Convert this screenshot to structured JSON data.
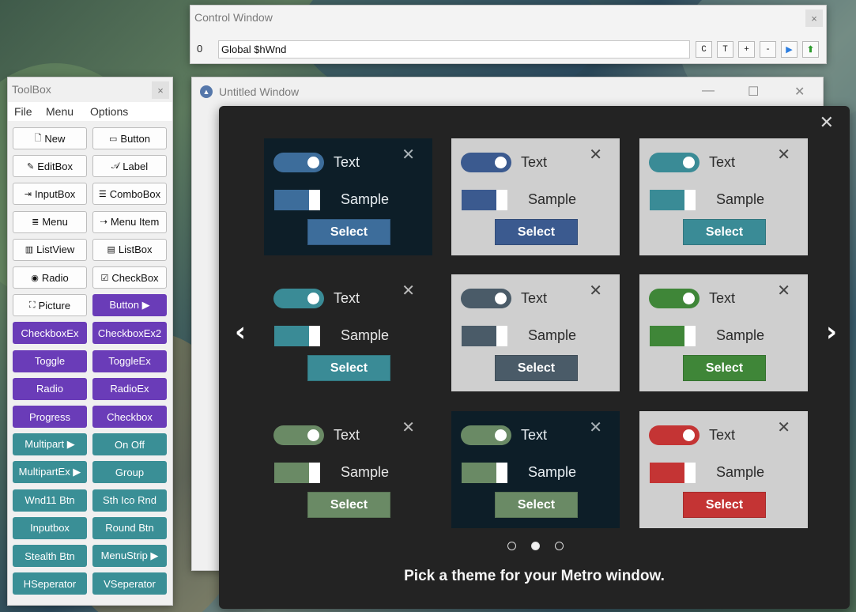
{
  "control_window": {
    "title": "Control Window",
    "close": "×",
    "handle_value": "0",
    "input_value": "Global $hWnd",
    "buttons": [
      "C",
      "T",
      "+",
      "-"
    ],
    "play_icon": "▶",
    "up_icon": "⬆"
  },
  "untitled_window": {
    "title": "Untitled Window",
    "icon": "▲",
    "minimize": "—",
    "maximize": "☐",
    "close": "✕"
  },
  "theme_picker": {
    "close": "✕",
    "prev": "‹",
    "next": "›",
    "caption": "Pick a theme for your Metro window.",
    "tiles": [
      {
        "bg": "#0d1e28",
        "accent": "#3d6d9b",
        "fg": "#e8eef2",
        "x_color": "#aab3b8",
        "text": "Text",
        "sample": "Sample",
        "select": "Select",
        "close": "✕"
      },
      {
        "bg": "#cfcfcf",
        "accent": "#3b5a8f",
        "fg": "#2b2b2b",
        "x_color": "#444",
        "text": "Text",
        "sample": "Sample",
        "select": "Select",
        "close": "✕"
      },
      {
        "bg": "#cfcfcf",
        "accent": "#3a8b96",
        "fg": "#2b2b2b",
        "x_color": "#444",
        "text": "Text",
        "sample": "Sample",
        "select": "Select",
        "close": "✕"
      },
      {
        "bg": "#232323",
        "accent": "#3a8b96",
        "fg": "#e8e8e8",
        "x_color": "#bbbbbb",
        "text": "Text",
        "sample": "Sample",
        "select": "Select",
        "close": "✕"
      },
      {
        "bg": "#cfcfcf",
        "accent": "#4a5b68",
        "fg": "#2b2b2b",
        "x_color": "#444",
        "text": "Text",
        "sample": "Sample",
        "select": "Select",
        "close": "✕"
      },
      {
        "bg": "#cfcfcf",
        "accent": "#3f8638",
        "fg": "#2b2b2b",
        "x_color": "#444",
        "text": "Text",
        "sample": "Sample",
        "select": "Select",
        "close": "✕"
      },
      {
        "bg": "#232323",
        "accent": "#6a8a65",
        "fg": "#e8e8e8",
        "x_color": "#bbbbbb",
        "text": "Text",
        "sample": "Sample",
        "select": "Select",
        "close": "✕"
      },
      {
        "bg": "#0d1e28",
        "accent": "#6a8a65",
        "fg": "#e8eef2",
        "x_color": "#aab3b8",
        "text": "Text",
        "sample": "Sample",
        "select": "Select",
        "close": "✕"
      },
      {
        "bg": "#cfcfcf",
        "accent": "#c43434",
        "fg": "#2b2b2b",
        "x_color": "#444",
        "text": "Text",
        "sample": "Sample",
        "select": "Select",
        "close": "✕"
      }
    ],
    "pager_active": 2
  },
  "toolbox": {
    "title": "ToolBox",
    "close": "×",
    "menu": [
      "File",
      "Menu",
      "Options"
    ],
    "buttons": [
      {
        "label": "New",
        "icon": "🗋",
        "style": "classic"
      },
      {
        "label": "Button",
        "icon": "▭",
        "style": "classic"
      },
      {
        "label": "EditBox",
        "icon": "✎",
        "style": "classic"
      },
      {
        "label": "Label",
        "icon": "𝒜",
        "style": "classic"
      },
      {
        "label": "InputBox",
        "icon": "⇥",
        "style": "classic"
      },
      {
        "label": "ComboBox",
        "icon": "☰",
        "style": "classic"
      },
      {
        "label": "Menu",
        "icon": "≣",
        "style": "classic"
      },
      {
        "label": "Menu Item",
        "icon": "⇢",
        "style": "classic"
      },
      {
        "label": "ListView",
        "icon": "▥",
        "style": "classic"
      },
      {
        "label": "ListBox",
        "icon": "▤",
        "style": "classic"
      },
      {
        "label": "Radio",
        "icon": "◉",
        "style": "classic"
      },
      {
        "label": "CheckBox",
        "icon": "☑",
        "style": "classic"
      },
      {
        "label": "Picture",
        "icon": "⛶",
        "style": "classic"
      },
      {
        "label": "Button ▶",
        "icon": "",
        "style": "purple"
      },
      {
        "label": "CheckboxEx",
        "icon": "",
        "style": "purple"
      },
      {
        "label": "CheckboxEx2",
        "icon": "",
        "style": "purple"
      },
      {
        "label": "Toggle",
        "icon": "",
        "style": "purple"
      },
      {
        "label": "ToggleEx",
        "icon": "",
        "style": "purple"
      },
      {
        "label": "Radio",
        "icon": "",
        "style": "purple"
      },
      {
        "label": "RadioEx",
        "icon": "",
        "style": "purple"
      },
      {
        "label": "Progress",
        "icon": "",
        "style": "purple"
      },
      {
        "label": "Checkbox",
        "icon": "",
        "style": "purple"
      },
      {
        "label": "Multipart ▶",
        "icon": "",
        "style": "teal"
      },
      {
        "label": "On Off",
        "icon": "",
        "style": "teal"
      },
      {
        "label": "MultipartEx ▶",
        "icon": "",
        "style": "teal"
      },
      {
        "label": "Group",
        "icon": "",
        "style": "teal"
      },
      {
        "label": "Wnd11 Btn",
        "icon": "",
        "style": "teal"
      },
      {
        "label": "Sth Ico Rnd",
        "icon": "",
        "style": "teal"
      },
      {
        "label": "Inputbox",
        "icon": "",
        "style": "teal"
      },
      {
        "label": "Round Btn",
        "icon": "",
        "style": "teal"
      },
      {
        "label": "Stealth Btn",
        "icon": "",
        "style": "teal"
      },
      {
        "label": "MenuStrip ▶",
        "icon": "",
        "style": "teal"
      },
      {
        "label": "HSeperator",
        "icon": "",
        "style": "teal"
      },
      {
        "label": "VSeperator",
        "icon": "",
        "style": "teal"
      }
    ]
  }
}
